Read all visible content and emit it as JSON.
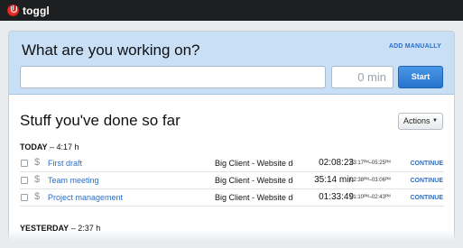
{
  "app": {
    "logo_text": "toggl",
    "logo_icon": "toggl-power-icon"
  },
  "entry": {
    "title": "What are you working on?",
    "add_manually": "ADD MANUALLY",
    "description_value": "",
    "minutes_value": "0 min",
    "start_label": "Start"
  },
  "list": {
    "title": "Stuff you've done so far",
    "actions_label": "Actions",
    "actions_caret": "▼"
  },
  "days": [
    {
      "label": "TODAY",
      "total": "– 4:17 h",
      "entries": [
        {
          "description": "First draft",
          "project": "Big Client - Website dev",
          "duration": "02:08:23",
          "range": "03:17ᴾᴹ–05:25ᴾᴹ",
          "continue": "CONTINUE"
        },
        {
          "description": "Team meeting",
          "project": "Big Client - Website dev",
          "duration": "35:14 min",
          "range": "02:38ᴾᴹ–03:06ᴾᴹ",
          "continue": "CONTINUE"
        },
        {
          "description": "Project management",
          "project": "Big Client - Website dev",
          "duration": "01:33:49",
          "range": "01:10ᴾᴹ–02:43ᴾᴹ",
          "continue": "CONTINUE"
        }
      ]
    },
    {
      "label": "YESTERDAY",
      "total": "– 2:37 h",
      "entries": []
    }
  ],
  "colors": {
    "topbar": "#1e1f21",
    "entry_bg": "#c9dff6",
    "link": "#2a6fc9",
    "start": "#2674cf",
    "logo": "#e8302b"
  }
}
